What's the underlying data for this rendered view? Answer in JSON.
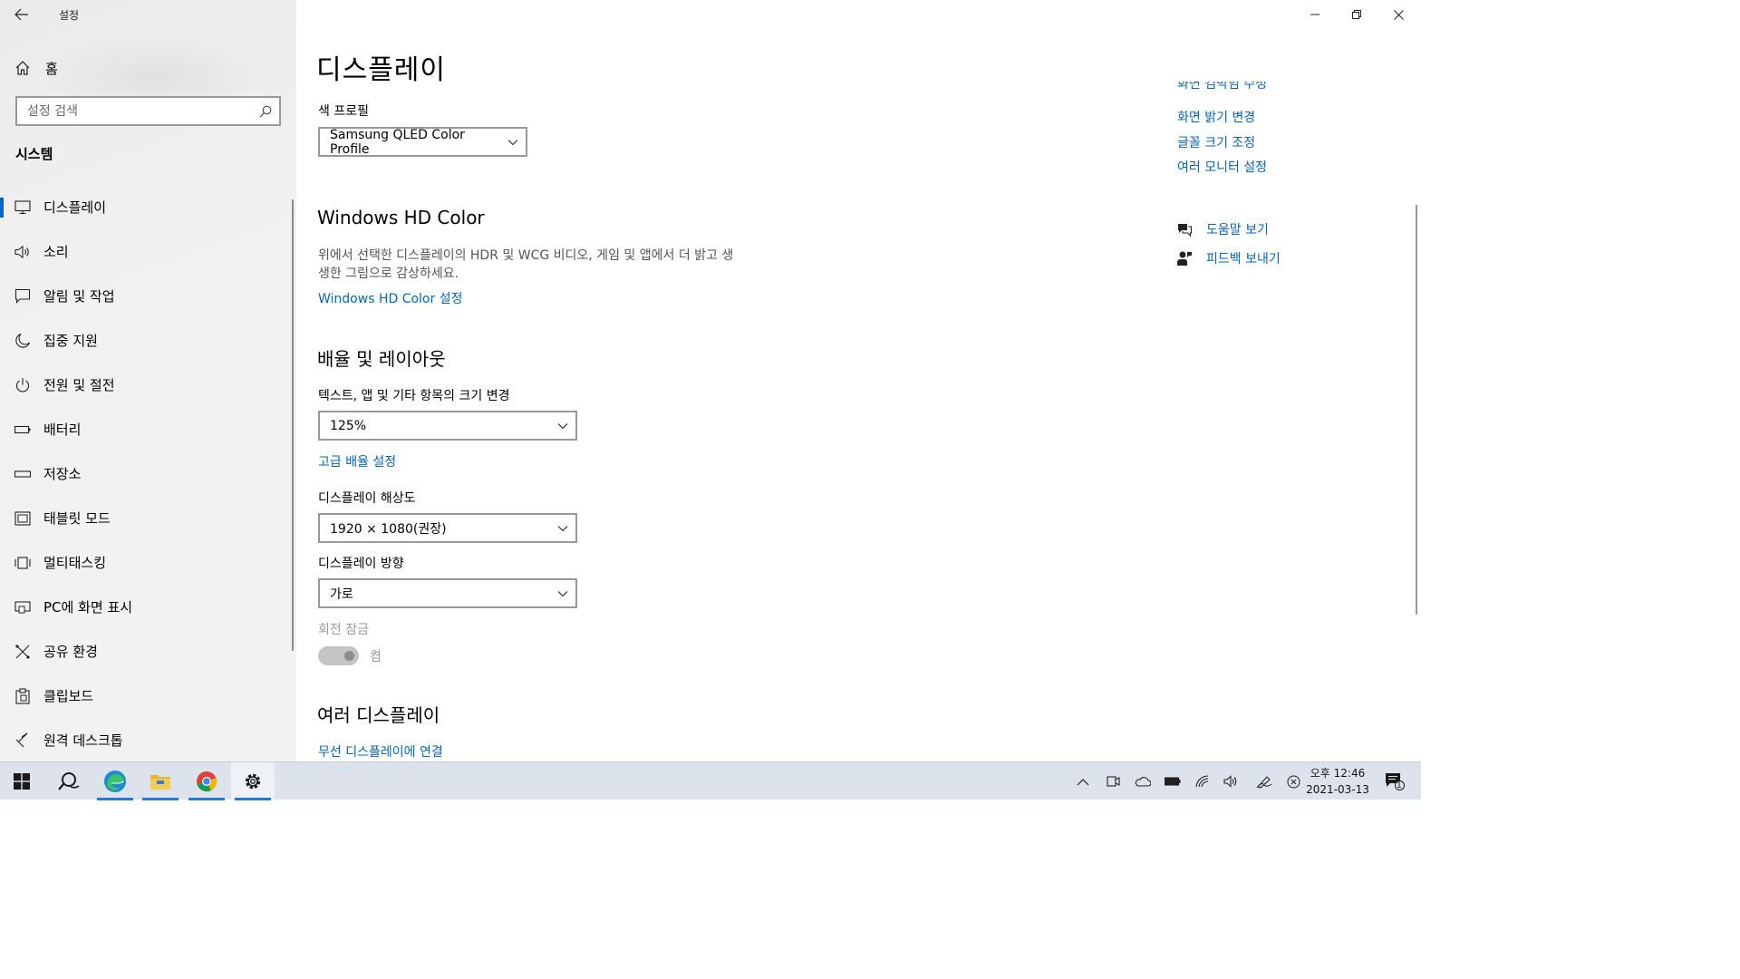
{
  "window": {
    "title": "설정",
    "controls": {
      "minimize": "minimize",
      "restore": "restore",
      "close": "close"
    }
  },
  "sidebar": {
    "home_label": "홈",
    "search_placeholder": "설정 검색",
    "section_title": "시스템",
    "items": [
      {
        "label": "디스플레이",
        "icon": "monitor-icon",
        "active": true
      },
      {
        "label": "소리",
        "icon": "speaker-icon"
      },
      {
        "label": "알림 및 작업",
        "icon": "message-icon"
      },
      {
        "label": "집중 지원",
        "icon": "moon-icon"
      },
      {
        "label": "전원 및 절전",
        "icon": "power-icon"
      },
      {
        "label": "배터리",
        "icon": "battery-icon"
      },
      {
        "label": "저장소",
        "icon": "drive-icon"
      },
      {
        "label": "태블릿 모드",
        "icon": "tablet-icon"
      },
      {
        "label": "멀티태스킹",
        "icon": "multitask-icon"
      },
      {
        "label": "PC에 화면 표시",
        "icon": "project-icon"
      },
      {
        "label": "공유 환경",
        "icon": "share-icon"
      },
      {
        "label": "클립보드",
        "icon": "clipboard-icon"
      },
      {
        "label": "원격 데스크톱",
        "icon": "remote-icon"
      }
    ]
  },
  "main": {
    "title": "디스플레이",
    "color_profile": {
      "label": "색 프로필",
      "value": "Samsung QLED Color Profile"
    },
    "hd_color": {
      "heading": "Windows HD Color",
      "description": "위에서 선택한 디스플레이의 HDR 및 WCG 비디오, 게임 및 앱에서 더 밝고 생생한 그림으로 감상하세요.",
      "link": "Windows HD Color 설정"
    },
    "scale_layout": {
      "heading": "배율 및 레이아웃",
      "scale_label": "텍스트, 앱 및 기타 항목의 크기 변경",
      "scale_value": "125%",
      "advanced_link": "고급 배율 설정",
      "resolution_label": "디스플레이 해상도",
      "resolution_value": "1920 × 1080(권장)",
      "orientation_label": "디스플레이 방향",
      "orientation_value": "가로",
      "rotation_lock_label": "회전 잠금",
      "rotation_lock_state": "켬"
    },
    "multi_display": {
      "heading": "여러 디스플레이",
      "wireless_link": "무선 디스플레이에 연결"
    }
  },
  "related": {
    "partial_link": "화면 검박임 수정",
    "links": [
      "화면 밝기 변경",
      "글꼴 크기 조정",
      "여러 모니터 설정"
    ],
    "help": [
      {
        "label": "도움말 보기",
        "icon": "help-icon"
      },
      {
        "label": "피드백 보내기",
        "icon": "feedback-icon"
      }
    ]
  },
  "taskbar": {
    "apps": [
      {
        "name": "start-button"
      },
      {
        "name": "search-button"
      },
      {
        "name": "edge-app",
        "open": true
      },
      {
        "name": "file-explorer-app",
        "open": true
      },
      {
        "name": "chrome-app",
        "open": true
      },
      {
        "name": "settings-app",
        "open": true,
        "active": true
      }
    ],
    "clock": {
      "time": "오후 12:46",
      "date": "2021-03-13"
    },
    "notification_count": "1",
    "accent": "#0067c0"
  }
}
